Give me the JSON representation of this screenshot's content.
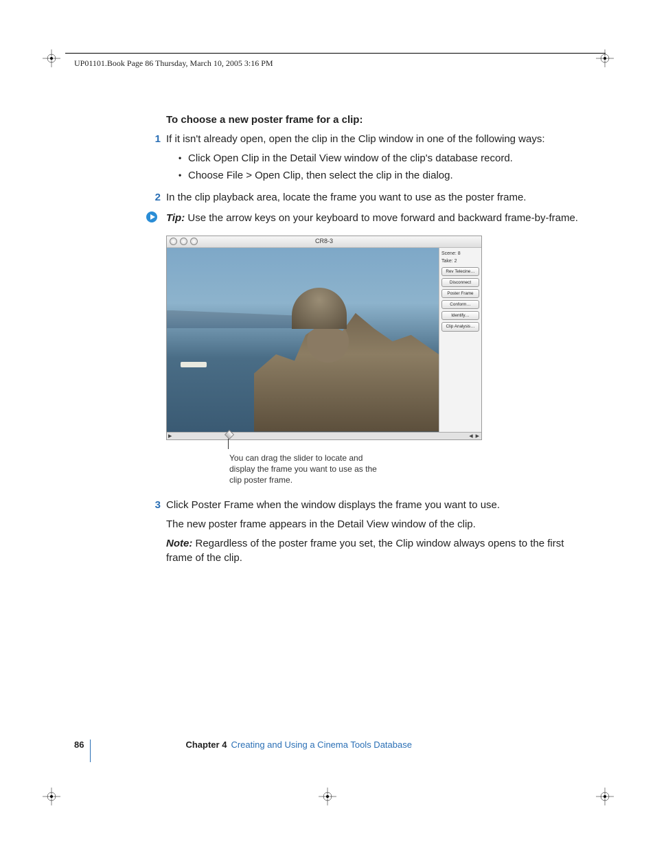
{
  "header": "UP01101.Book  Page 86  Thursday, March 10, 2005  3:16 PM",
  "heading": "To choose a new poster frame for a clip:",
  "steps": {
    "s1_num": "1",
    "s1": "If it isn't already open, open the clip in the Clip window in one of the following ways:",
    "b1": "Click Open Clip in the Detail View window of the clip's database record.",
    "b2": "Choose File > Open Clip, then select the clip in the dialog.",
    "s2_num": "2",
    "s2": "In the clip playback area, locate the frame you want to use as the poster frame.",
    "tip_label": "Tip:",
    "tip": "  Use the arrow keys on your keyboard to move forward and backward frame-by-frame.",
    "s3_num": "3",
    "s3": "Click Poster Frame when the window displays the frame you want to use.",
    "after3": "The new poster frame appears in the Detail View window of the clip.",
    "note_label": "Note:",
    "note": "  Regardless of the poster frame you set, the Clip window always opens to the first frame of the clip."
  },
  "window": {
    "title": "CR8-3",
    "scene": "Scene: 8",
    "take": "Take: 2",
    "buttons": [
      "Rev Telecine…",
      "Disconnect",
      "Poster Frame",
      "Conform…",
      "Identify…",
      "Clip Analysis…"
    ]
  },
  "callout": "You can drag the slider to locate and display the frame you want to use as the clip poster frame.",
  "footer": {
    "page": "86",
    "chapter": "Chapter 4",
    "title": "Creating and Using a Cinema Tools Database"
  }
}
